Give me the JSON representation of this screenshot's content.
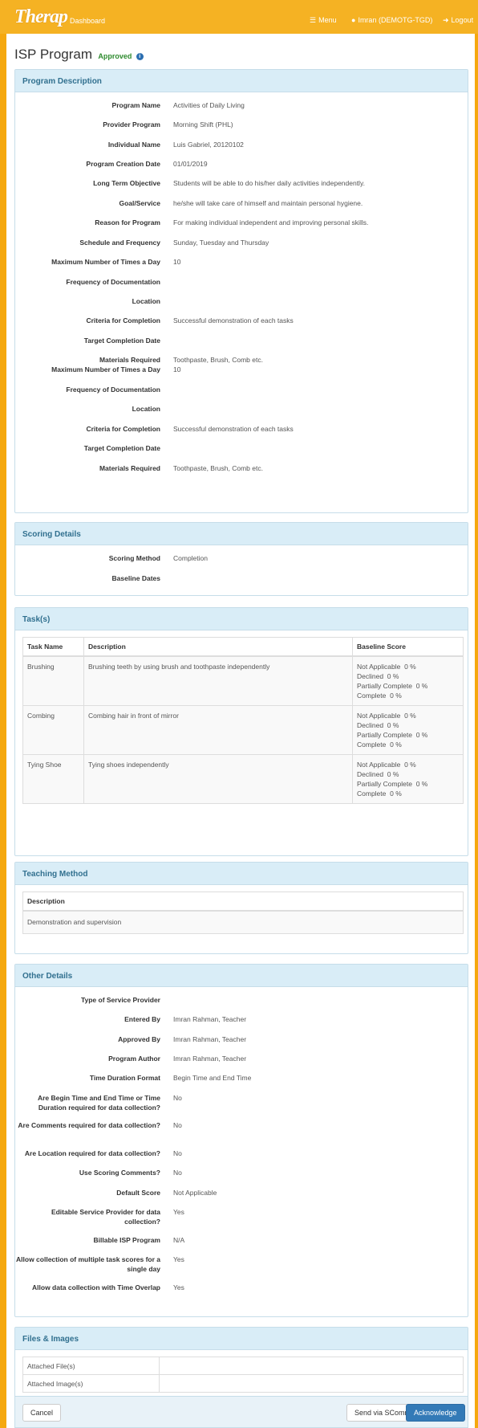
{
  "navbar": {
    "logo": "Therap",
    "dashboard": "Dashboard",
    "menu": "Menu",
    "user": "Imran (DEMOTG-TGD)",
    "logout": "Logout"
  },
  "header": {
    "title": "ISP Program",
    "status": "Approved"
  },
  "program_description": {
    "heading": "Program Description",
    "rows": [
      {
        "label": "Program Name",
        "value": "Activities of Daily Living"
      },
      {
        "label": "Provider Program",
        "value": "Morning Shift (PHL)"
      },
      {
        "label": "Individual Name",
        "value": "Luis Gabriel, 20120102"
      },
      {
        "label": "Program Creation Date",
        "value": "01/01/2019"
      },
      {
        "label": "Long Term Objective",
        "value": "Students will be able to do his/her daily activities independently."
      },
      {
        "label": "Goal/Service",
        "value": "he/she will take care of himself and maintain personal hygiene."
      },
      {
        "label": "Reason for Program",
        "value": "For making individual independent and improving personal skills."
      },
      {
        "label": "Schedule and Frequency",
        "value": "Sunday, Tuesday and Thursday"
      },
      {
        "label": "Maximum Number of Times a Day",
        "value": "10"
      },
      {
        "label": "Frequency of Documentation",
        "value": ""
      },
      {
        "label": "Location",
        "value": ""
      },
      {
        "label": "Criteria for Completion",
        "value": "Successful demonstration of each tasks"
      },
      {
        "label": "Target Completion Date",
        "value": ""
      },
      {
        "label": "Materials Required",
        "value": "Toothpaste, Brush, Comb etc."
      },
      {
        "label": "Maximum Number of Times a Day",
        "value": "10"
      },
      {
        "label": "Frequency of Documentation",
        "value": ""
      },
      {
        "label": "Location",
        "value": ""
      },
      {
        "label": "Criteria for Completion",
        "value": "Successful demonstration of each tasks"
      },
      {
        "label": "Target Completion Date",
        "value": ""
      },
      {
        "label": "Materials Required",
        "value": "Toothpaste, Brush, Comb etc."
      }
    ]
  },
  "scoring_details": {
    "heading": "Scoring Details",
    "rows": [
      {
        "label": "Scoring Method",
        "value": "Completion"
      },
      {
        "label": "Baseline Dates",
        "value": ""
      }
    ]
  },
  "tasks": {
    "heading": "Task(s)",
    "columns": [
      "Task Name",
      "Description",
      "Baseline Score"
    ],
    "rows": [
      {
        "name": "Brushing",
        "description": "Brushing teeth by using brush and toothpaste independently",
        "scores": [
          "Not Applicable  0 %",
          "Declined  0 %",
          "Partially Complete  0 %",
          "Complete  0 %"
        ]
      },
      {
        "name": "Combing",
        "description": "Combing hair in front of mirror",
        "scores": [
          "Not Applicable  0 %",
          "Declined  0 %",
          "Partially Complete  0 %",
          "Complete  0 %"
        ]
      },
      {
        "name": "Tying Shoe",
        "description": "Tying shoes independently",
        "scores": [
          "Not Applicable  0 %",
          "Declined  0 %",
          "Partially Complete  0 %",
          "Complete  0 %"
        ]
      }
    ]
  },
  "teaching_method": {
    "heading": "Teaching Method",
    "column": "Description",
    "value": "Demonstration and supervision"
  },
  "other_details": {
    "heading": "Other Details",
    "rows": [
      {
        "label": "Type of Service Provider",
        "value": ""
      },
      {
        "label": "Entered By",
        "value": "Imran Rahman, Teacher"
      },
      {
        "label": "Approved By",
        "value": "Imran Rahman, Teacher"
      },
      {
        "label": "Program Author",
        "value": "Imran Rahman, Teacher"
      },
      {
        "label": "Time Duration Format",
        "value": "Begin Time and End Time"
      },
      {
        "label": "Are Begin Time and End Time or Time Duration required for data collection?",
        "value": "No"
      },
      {
        "label": "Are Comments required for data collection?",
        "value": "No"
      },
      {
        "label": "Are Location required for data collection?",
        "value": "No"
      },
      {
        "label": "Use Scoring Comments?",
        "value": "No"
      },
      {
        "label": "Default Score",
        "value": "Not Applicable"
      },
      {
        "label": "Editable Service Provider for data collection?",
        "value": "Yes"
      },
      {
        "label": "Billable ISP Program",
        "value": "N/A"
      },
      {
        "label": "Allow collection of multiple task scores for a single day",
        "value": "Yes"
      },
      {
        "label": "Allow data collection with Time Overlap",
        "value": "Yes"
      }
    ]
  },
  "files_images": {
    "heading": "Files & Images",
    "rows": [
      {
        "label": "Attached File(s)",
        "value": ""
      },
      {
        "label": "Attached Image(s)",
        "value": ""
      }
    ]
  },
  "actions": {
    "cancel": "Cancel",
    "send": "Send via SComm",
    "acknowledge": "Acknowledge"
  }
}
